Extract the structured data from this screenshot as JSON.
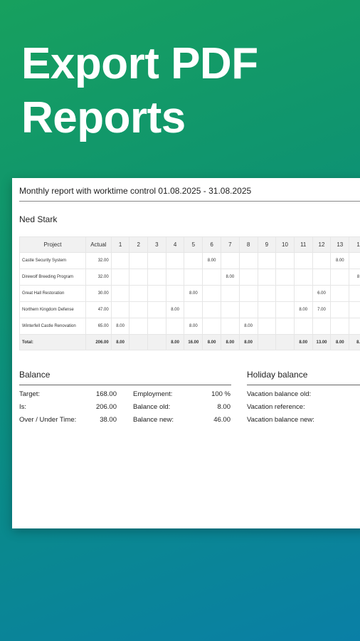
{
  "hero": {
    "line1": "Export PDF",
    "line2": "Reports"
  },
  "report": {
    "title": "Monthly report with worktime control 01.08.2025 - 31.08.2025",
    "person": "Ned Stark",
    "table": {
      "headers": [
        "Project",
        "Actual",
        "1",
        "2",
        "3",
        "4",
        "5",
        "6",
        "7",
        "8",
        "9",
        "10",
        "11",
        "12",
        "13",
        "1"
      ],
      "rows": [
        {
          "project": "Castle Security System",
          "actual": "32.00",
          "days": [
            "",
            "",
            "",
            "",
            "",
            "8.00",
            "",
            "",
            "",
            "",
            "",
            "",
            "8.00",
            ""
          ]
        },
        {
          "project": "Direwolf Breeding Program",
          "actual": "32.00",
          "days": [
            "",
            "",
            "",
            "",
            "",
            "",
            "8.00",
            "",
            "",
            "",
            "",
            "",
            "",
            "8"
          ]
        },
        {
          "project": "Great Hall Restoration",
          "actual": "30.00",
          "days": [
            "",
            "",
            "",
            "",
            "8.00",
            "",
            "",
            "",
            "",
            "",
            "",
            "6.00",
            "",
            ""
          ]
        },
        {
          "project": "Northern Kingdom Defense",
          "actual": "47.00",
          "days": [
            "",
            "",
            "",
            "8.00",
            "",
            "",
            "",
            "",
            "",
            "",
            "8.00",
            "7.00",
            "",
            ""
          ]
        },
        {
          "project": "Winterfell Castle Renovation",
          "actual": "65.00",
          "days": [
            "8.00",
            "",
            "",
            "",
            "8.00",
            "",
            "",
            "8.00",
            "",
            "",
            "",
            "",
            "",
            ""
          ]
        }
      ],
      "total": {
        "label": "Total:",
        "actual": "206.00",
        "days": [
          "8.00",
          "",
          "",
          "8.00",
          "16.00",
          "8.00",
          "8.00",
          "8.00",
          "",
          "",
          "8.00",
          "13.00",
          "8.00",
          "8."
        ]
      }
    },
    "balance": {
      "title": "Balance",
      "target_label": "Target:",
      "target_value": "168.00",
      "is_label": "Is:",
      "is_value": "206.00",
      "over_label": "Over / Under Time:",
      "over_value": "38.00",
      "employment_label": "Employment:",
      "employment_value": "100 %",
      "old_label": "Balance old:",
      "old_value": "8.00",
      "new_label": "Balance new:",
      "new_value": "46.00"
    },
    "holiday": {
      "title": "Holiday balance",
      "old_label": "Vacation balance old:",
      "reference_label": "Vacation reference:",
      "new_label": "Vacation balance new:"
    }
  }
}
